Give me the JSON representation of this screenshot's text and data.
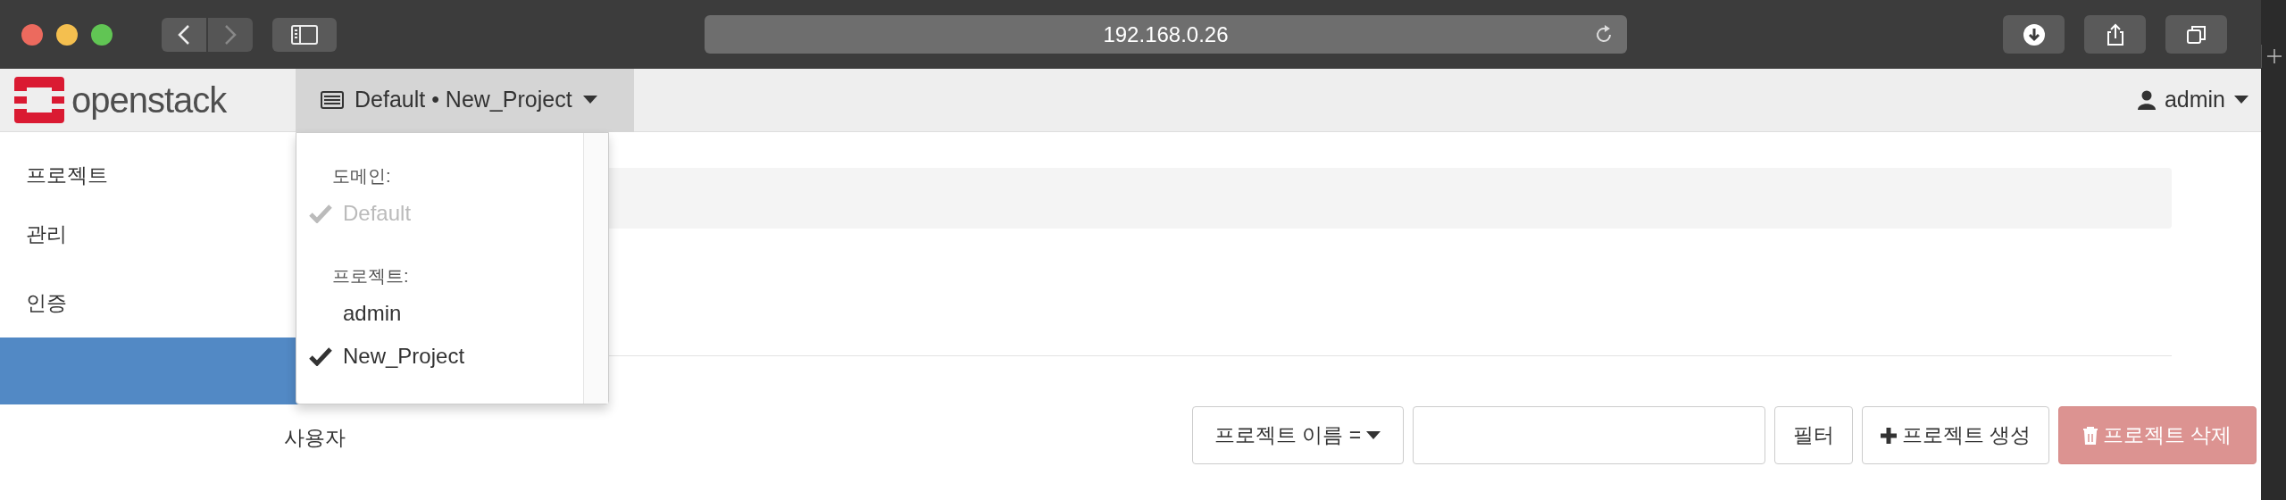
{
  "browser": {
    "url": "192.168.0.26"
  },
  "navbar": {
    "logo": "openstack",
    "context": {
      "domain": "Default",
      "separator": "•",
      "project": "New_Project"
    },
    "user": "admin"
  },
  "sidebar": {
    "items": [
      {
        "label": "프로젝트",
        "selected": false
      },
      {
        "label": "관리",
        "selected": false
      },
      {
        "label": "인증",
        "selected": false,
        "children": [
          {
            "selected": true
          },
          {
            "label": "사용자",
            "selected": false
          }
        ]
      }
    ]
  },
  "context_menu": {
    "sections": [
      {
        "heading": "도메인:",
        "items": [
          {
            "label": "Default",
            "selected": true,
            "disabled": true
          }
        ]
      },
      {
        "heading": "프로젝트:",
        "items": [
          {
            "label": "admin",
            "selected": false,
            "disabled": false
          },
          {
            "label": "New_Project",
            "selected": true,
            "disabled": false
          }
        ]
      }
    ]
  },
  "toolbar": {
    "filter_select": "프로젝트 이름 =",
    "buttons": [
      {
        "kind": "filter",
        "label": "필터",
        "disabled": false
      },
      {
        "kind": "create",
        "label": "프로젝트 생성",
        "disabled": false
      },
      {
        "kind": "delete",
        "label": "프로젝트 삭제",
        "disabled": true
      }
    ]
  }
}
